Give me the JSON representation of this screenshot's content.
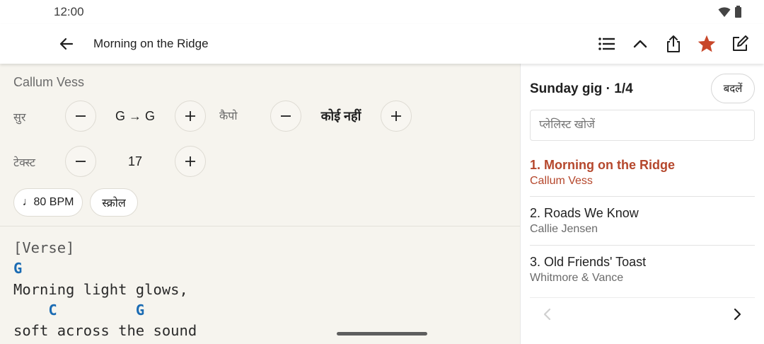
{
  "status": {
    "time": "12:00"
  },
  "app_bar": {
    "title": "Morning on the Ridge",
    "icons": [
      "back-arrow-icon",
      "list-icon",
      "chevron-up-icon",
      "share-icon",
      "star-icon",
      "edit-icon"
    ],
    "favorite_color": "#c8472a"
  },
  "song": {
    "artist": "Callum Vess",
    "transpose": {
      "label": "सुर",
      "value": "G → G"
    },
    "capo": {
      "label": "कैपो",
      "value": "कोई नहीं"
    },
    "text_size": {
      "label": "टेक्स्ट",
      "value": "17"
    },
    "bpm_label": "♩80 BPM",
    "scroll_label": "स्क्रोल",
    "sheet": {
      "section": "[Verse]",
      "chord_line_1": "G",
      "lyric_line_1": "Morning light glows,",
      "chord_line_2a": "C",
      "chord_line_2b": "G",
      "lyric_line_2": "soft across the sound"
    },
    "chord_color": "#1a6bb3"
  },
  "playlist": {
    "title": "Sunday gig · 1/4",
    "change_label": "बदलें",
    "search_placeholder": "प्लेलिस्ट खोजें",
    "items": [
      {
        "title": "1. Morning on the Ridge",
        "artist": "Callum Vess",
        "active": true
      },
      {
        "title": "2. Roads We Know",
        "artist": "Callie Jensen",
        "active": false
      },
      {
        "title": "3. Old Friends' Toast",
        "artist": "Whitmore & Vance",
        "active": false
      }
    ],
    "active_color": "#b5472c"
  }
}
